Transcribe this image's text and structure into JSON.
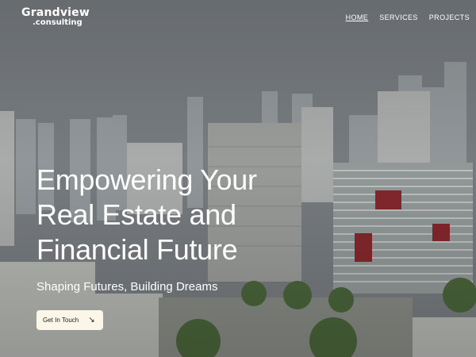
{
  "brand": {
    "name": "Grandview",
    "sub": ".consulting"
  },
  "nav": {
    "items": [
      {
        "label": "HOME",
        "active": true
      },
      {
        "label": "SERVICES",
        "active": false
      },
      {
        "label": "PROJECTS",
        "active": false
      }
    ]
  },
  "hero": {
    "headline": [
      "Empowering Your",
      "Real Estate and",
      "Financial Future"
    ],
    "subheadline": "Shaping Futures, Building Dreams",
    "cta_label": "Get In Touch",
    "cta_icon": "arrow-down-right-icon"
  },
  "colors": {
    "cta_bg": "#fbf6e8",
    "text": "#ffffff"
  }
}
